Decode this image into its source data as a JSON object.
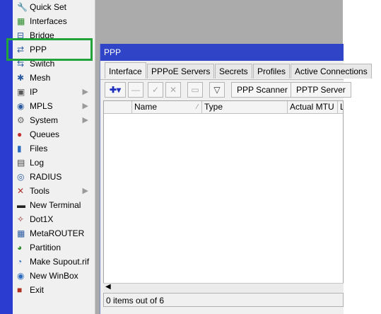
{
  "sidebar": {
    "items": [
      {
        "label": "Quick Set",
        "icon": "quick-set-icon",
        "submenu": false
      },
      {
        "label": "Interfaces",
        "icon": "interfaces-icon",
        "submenu": false
      },
      {
        "label": "Bridge",
        "icon": "bridge-icon",
        "submenu": false
      },
      {
        "label": "PPP",
        "icon": "ppp-icon",
        "submenu": false
      },
      {
        "label": "Switch",
        "icon": "switch-icon",
        "submenu": false
      },
      {
        "label": "Mesh",
        "icon": "mesh-icon",
        "submenu": false
      },
      {
        "label": "IP",
        "icon": "ip-icon",
        "submenu": true
      },
      {
        "label": "MPLS",
        "icon": "mpls-icon",
        "submenu": true
      },
      {
        "label": "System",
        "icon": "system-icon",
        "submenu": true
      },
      {
        "label": "Queues",
        "icon": "queues-icon",
        "submenu": false
      },
      {
        "label": "Files",
        "icon": "files-icon",
        "submenu": false
      },
      {
        "label": "Log",
        "icon": "log-icon",
        "submenu": false
      },
      {
        "label": "RADIUS",
        "icon": "radius-icon",
        "submenu": false
      },
      {
        "label": "Tools",
        "icon": "tools-icon",
        "submenu": true
      },
      {
        "label": "New Terminal",
        "icon": "terminal-icon",
        "submenu": false
      },
      {
        "label": "Dot1X",
        "icon": "dot1x-icon",
        "submenu": false
      },
      {
        "label": "MetaROUTER",
        "icon": "metarouter-icon",
        "submenu": false
      },
      {
        "label": "Partition",
        "icon": "partition-icon",
        "submenu": false
      },
      {
        "label": "Make Supout.rif",
        "icon": "supout-icon",
        "submenu": false
      },
      {
        "label": "New WinBox",
        "icon": "winbox-icon",
        "submenu": false
      },
      {
        "label": "Exit",
        "icon": "exit-icon",
        "submenu": false
      }
    ],
    "submenu_arrow": "▶"
  },
  "window": {
    "title": "PPP",
    "tabs": [
      "Interface",
      "PPPoE Servers",
      "Secrets",
      "Profiles",
      "Active Connections"
    ],
    "toolbar": {
      "add": "✚▾",
      "remove": "—",
      "enable": "✓",
      "disable": "✕",
      "comment": "▭",
      "filter": "▽",
      "ppp_scanner": "PPP Scanner",
      "pptp_server": "PPTP Server"
    },
    "columns": [
      "Name",
      "Type",
      "Actual MTU",
      "L"
    ],
    "status": "0 items out of 6"
  },
  "colors": {
    "accent_strip": "#2b3cd1",
    "titlebar": "#2f44c7",
    "highlight": "#1fa33a"
  }
}
